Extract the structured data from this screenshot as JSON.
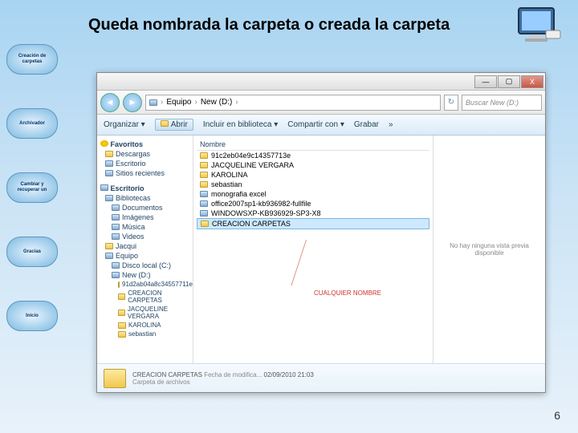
{
  "slide": {
    "title": "Queda nombrada la carpeta o creada la carpeta",
    "page_number": "6"
  },
  "sidebar_pills": {
    "p1": "Creación de carpetas",
    "p2": "Archivador",
    "p3": "Cambiar y recuperar un",
    "p4": "Gracias",
    "p5": "Inicio"
  },
  "explorer": {
    "window_controls": {
      "min": "—",
      "max": "▢",
      "close": "X"
    },
    "nav": {
      "back": "◄",
      "fwd": "►"
    },
    "address": {
      "seg1": "Equipo",
      "seg2": "New (D:)",
      "sep": "›"
    },
    "search_placeholder": "Buscar New (D:)",
    "toolbar": {
      "organize": "Organizar ▾",
      "open": "Abrir",
      "include": "Incluir en biblioteca ▾",
      "share": "Compartir con ▾",
      "burn": "Grabar",
      "more": "»"
    },
    "tree": {
      "favorites": "Favoritos",
      "downloads": "Descargas",
      "desktop": "Escritorio",
      "recent": "Sitios recientes",
      "desktop_section": "Escritorio",
      "libraries": "Bibliotecas",
      "documents": "Documentos",
      "images": "Imágenes",
      "music": "Música",
      "videos": "Videos",
      "user": "Jacqui",
      "computer": "Equipo",
      "local_c": "Disco local (C:)",
      "new_d": "New (D:)",
      "sub1": "91d2ab04a8c34557711e",
      "sub2": "CREACION CARPETAS",
      "sub3": "JACQUELINE VERGARA",
      "sub4": "KAROLINA",
      "sub5": "sebastian"
    },
    "list": {
      "col_name": "Nombre",
      "items": {
        "i1": "91c2eb04e9c14357713e",
        "i2": "JACQUELINE VERGARA",
        "i3": "KAROLINA",
        "i4": "sebastian",
        "i5": "monografia excel",
        "i6": "office2007sp1-kb936982-fullfile",
        "i7": "WINDOWSXP-KB936929-SP3-X8",
        "i8": "CREACION CARPETAS"
      }
    },
    "preview_text": "No hay ninguna vista previa disponible",
    "annotation": "CUALQUIER NOMBRE",
    "status": {
      "name": "CREACION CARPETAS",
      "date_label": "Fecha de modifica...",
      "date": "02/09/2010 21:03",
      "type": "Carpeta de archivos"
    }
  }
}
